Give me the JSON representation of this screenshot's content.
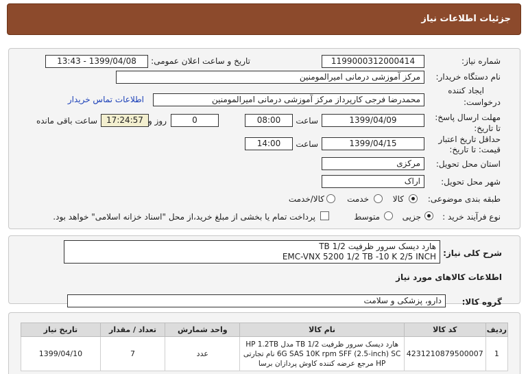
{
  "header": {
    "title": "جزئیات اطلاعات نیاز"
  },
  "form": {
    "need_number_label": "شماره نیاز:",
    "need_number": "1199000312000414",
    "announce_label": "تاریخ و ساعت اعلان عمومی:",
    "announce_value": "1399/04/08 - 13:43",
    "buyer_org_label": "نام دستگاه خریدار:",
    "buyer_org": "مرکز آموزشی درمانی امیرالمومنین",
    "creator_label_1": "ایجاد کننده",
    "creator_label_2": "درخواست:",
    "creator": "محمدرضا فرجی کارپرداز مرکز آموزشی درمانی امیرالمومنین",
    "contact_link": "اطلاعات تماس خریدار",
    "deadline_label_1": "مهلت ارسال پاسخ:",
    "deadline_label_2": "تا تاریخ:",
    "deadline_date": "1399/04/09",
    "time_label": "ساعت",
    "deadline_time": "08:00",
    "days_value": "0",
    "days_label": "روز و",
    "remaining_time": "17:24:57",
    "remaining_label": "ساعت باقی مانده",
    "validity_label_1": "حداقل تاریخ اعتبار",
    "validity_label_2": "قیمت: تا تاریخ:",
    "validity_date": "1399/04/15",
    "validity_time": "14:00",
    "province_label": "استان محل تحویل:",
    "province": "مرکزی",
    "city_label": "شهر محل تحویل:",
    "city": "اراک",
    "category_label": "طبقه بندی موضوعی:",
    "category_options": [
      "کالا",
      "خدمت",
      "کالا/خدمت"
    ],
    "category_selected": "کالا",
    "process_label": "نوع فرآیند خرید :",
    "process_options": [
      "جزیی",
      "متوسط"
    ],
    "process_selected": "جزیی",
    "payment_note": "پرداخت تمام یا بخشی از مبلغ خرید،از محل \"اسناد خزانه اسلامی\" خواهد بود."
  },
  "description": {
    "label": "شرح کلی نیاز:",
    "line1": "هارد دیسک سرور ظرفیت TB 1/2",
    "line2": "EMC-VNX 5200 1/2 TB -10 K  2/5 INCH"
  },
  "goods": {
    "section_title": "اطلاعات کالاهای مورد نیاز",
    "group_label": "گروه کالا:",
    "group_value": "دارو، پزشکی و سلامت",
    "columns": [
      "ردیف",
      "کد کالا",
      "نام کالا",
      "واحد شمارش",
      "تعداد / مقدار",
      "تاریخ نیاز"
    ],
    "rows": [
      {
        "row": "1",
        "code": "4231210879500007",
        "name": "هارد دیسک سرور ظرفیت 1/2 TB مدل HP 1.2TB 6G SAS 10K rpm SFF (2.5-inch) SC نام تجارتی HP مرجع عرضه کننده کاوش پردازان برسا",
        "unit": "عدد",
        "qty": "7",
        "date": "1399/04/10"
      }
    ]
  }
}
